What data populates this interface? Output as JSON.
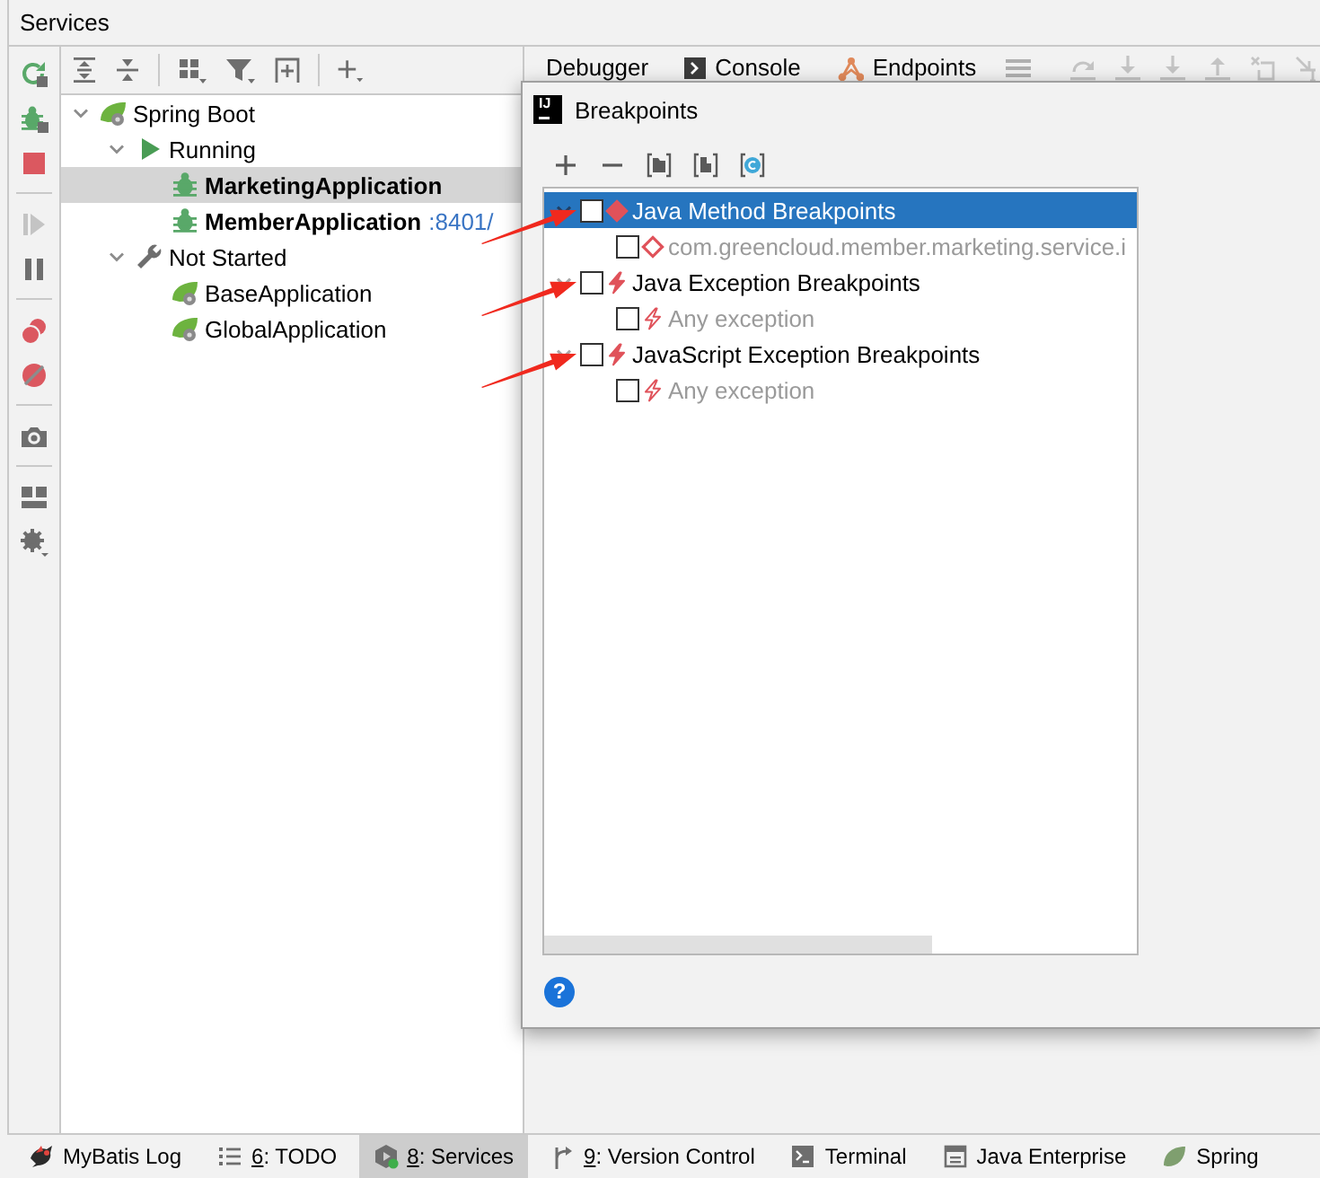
{
  "window": {
    "title": "Services"
  },
  "services": {
    "tree": [
      {
        "label": "Spring Boot",
        "kind": "group",
        "expanded": true,
        "selected": false,
        "children": [
          {
            "label": "Running",
            "kind": "status-running",
            "expanded": true,
            "selected": false,
            "children": [
              {
                "label": "MarketingApplication",
                "kind": "app-running",
                "selected": true
              },
              {
                "label": "MemberApplication",
                "port": ":8401/",
                "kind": "app-running",
                "selected": false
              }
            ]
          },
          {
            "label": "Not Started",
            "kind": "status-stopped",
            "expanded": true,
            "selected": false,
            "children": [
              {
                "label": "BaseApplication",
                "kind": "app-stopped",
                "selected": false
              },
              {
                "label": "GlobalApplication",
                "kind": "app-stopped",
                "selected": false
              }
            ]
          }
        ]
      }
    ]
  },
  "debugger_tabs": [
    {
      "label": "Debugger",
      "kind": "debugger"
    },
    {
      "label": "Console",
      "kind": "console"
    },
    {
      "label": "Endpoints",
      "kind": "endpoints"
    }
  ],
  "breakpoints_dialog": {
    "logo": "IJ",
    "title": "Breakpoints",
    "groups": [
      {
        "label": "Java Method Breakpoints",
        "kind": "method",
        "expanded": true,
        "checked": false,
        "selected": true,
        "annotated": true,
        "children": [
          {
            "label": "com.greencloud.member.marketing.service.i",
            "kind": "method",
            "checked": false,
            "selected": false
          }
        ]
      },
      {
        "label": "Java Exception Breakpoints",
        "kind": "exception",
        "expanded": true,
        "checked": false,
        "selected": false,
        "annotated": true,
        "children": [
          {
            "label": "Any exception",
            "kind": "exception",
            "checked": false,
            "selected": false
          }
        ]
      },
      {
        "label": "JavaScript Exception Breakpoints",
        "kind": "exception",
        "expanded": true,
        "checked": false,
        "selected": false,
        "annotated": true,
        "children": [
          {
            "label": "Any exception",
            "kind": "exception",
            "checked": false,
            "selected": false
          }
        ]
      }
    ],
    "help": "?"
  },
  "tool_windows": [
    {
      "label": "MyBatis Log",
      "kind": "mybatis",
      "selected": false
    },
    {
      "mnemonic": "6",
      "label": ": TODO",
      "kind": "todo",
      "selected": false
    },
    {
      "mnemonic": "8",
      "label": ": Services",
      "kind": "services",
      "selected": true
    },
    {
      "mnemonic": "9",
      "label": ": Version Control",
      "kind": "vcs",
      "selected": false
    },
    {
      "label": "Terminal",
      "kind": "terminal",
      "selected": false
    },
    {
      "label": "Java Enterprise",
      "kind": "javaee",
      "selected": false
    },
    {
      "label": "Spring",
      "kind": "spring",
      "selected": false
    }
  ]
}
